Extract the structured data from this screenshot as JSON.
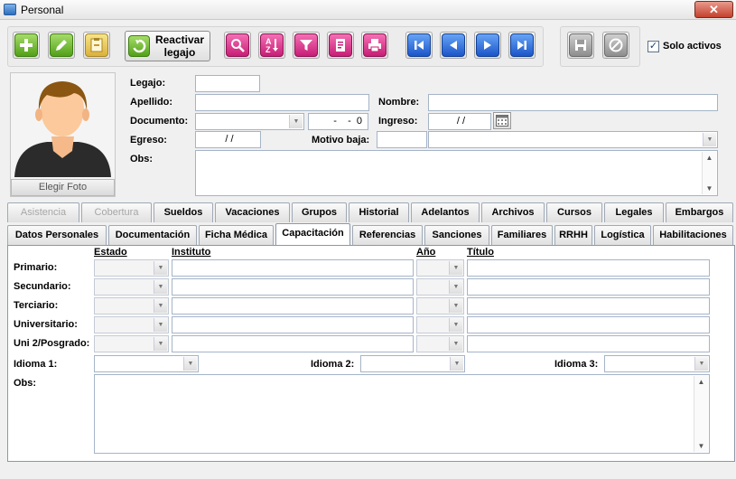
{
  "window": {
    "title": "Personal",
    "close_glyph": "✕"
  },
  "toolbar": {
    "buttons": [
      {
        "icon": "add-icon",
        "color": "#52a018"
      },
      {
        "icon": "edit-icon",
        "color": "#52a018"
      },
      {
        "icon": "paste-icon",
        "color": "#dcb13a"
      }
    ],
    "reactivar_label": "Reactivar legajo",
    "search_buttons": [
      {
        "icon": "search-icon",
        "color": "#c81d76"
      },
      {
        "icon": "sort-az-icon",
        "color": "#c81d76"
      },
      {
        "icon": "filter-icon",
        "color": "#c81d76"
      },
      {
        "icon": "report-icon",
        "color": "#c81d76"
      },
      {
        "icon": "print-icon",
        "color": "#c81d76"
      }
    ],
    "nav_buttons": [
      {
        "icon": "first-record-icon"
      },
      {
        "icon": "previous-record-icon"
      },
      {
        "icon": "next-record-icon"
      },
      {
        "icon": "last-record-icon"
      }
    ],
    "save_icon": "save-icon",
    "cancel_icon": "cancel-icon",
    "solo_activos_label": "Solo activos",
    "solo_activos_checked": true
  },
  "photo": {
    "button_label": "Elegir Foto"
  },
  "form": {
    "legajo_label": "Legajo:",
    "legajo_value": "",
    "apellido_label": "Apellido:",
    "apellido_value": "",
    "nombre_label": "Nombre:",
    "nombre_value": "",
    "documento_label": "Documento:",
    "documento_type": "",
    "documento_number": "  -    -  0",
    "ingreso_label": "Ingreso:",
    "ingreso_value": " / /",
    "egreso_label": "Egreso:",
    "egreso_value": " / /",
    "motivo_baja_label": "Motivo baja:",
    "motivo_baja_code": "",
    "motivo_baja_value": "",
    "obs_label": "Obs:",
    "obs_value": ""
  },
  "tabs_row1": [
    {
      "label": "Asistencia",
      "enabled": false
    },
    {
      "label": "Cobertura",
      "enabled": false
    },
    {
      "label": "Sueldos",
      "enabled": true
    },
    {
      "label": "Vacaciones",
      "enabled": true
    },
    {
      "label": "Grupos",
      "enabled": true
    },
    {
      "label": "Historial",
      "enabled": true
    },
    {
      "label": "Adelantos",
      "enabled": true
    },
    {
      "label": "Archivos",
      "enabled": true
    },
    {
      "label": "Cursos",
      "enabled": true
    },
    {
      "label": "Legales",
      "enabled": true
    },
    {
      "label": "Embargos",
      "enabled": true
    }
  ],
  "tabs_row2": [
    {
      "label": "Datos Personales",
      "selected": false
    },
    {
      "label": "Documentación",
      "selected": false
    },
    {
      "label": "Ficha Médica",
      "selected": false
    },
    {
      "label": "Capacitación",
      "selected": true
    },
    {
      "label": "Referencias",
      "selected": false
    },
    {
      "label": "Sanciones",
      "selected": false
    },
    {
      "label": "Familiares",
      "selected": false
    },
    {
      "label": "RRHH",
      "selected": false
    },
    {
      "label": "Logística",
      "selected": false
    },
    {
      "label": "Habilitaciones",
      "selected": false
    }
  ],
  "capacitacion": {
    "headers": {
      "estado": "Estado",
      "instituto": "Instituto",
      "anio": "Año",
      "titulo": "Título"
    },
    "rows": [
      {
        "label": "Primario:",
        "estado": "",
        "instituto": "",
        "anio": "",
        "titulo": ""
      },
      {
        "label": "Secundario:",
        "estado": "",
        "instituto": "",
        "anio": "",
        "titulo": ""
      },
      {
        "label": "Terciario:",
        "estado": "",
        "instituto": "",
        "anio": "",
        "titulo": ""
      },
      {
        "label": "Universitario:",
        "estado": "",
        "instituto": "",
        "anio": "",
        "titulo": ""
      },
      {
        "label": "Uni 2/Posgrado:",
        "estado": "",
        "instituto": "",
        "anio": "",
        "titulo": ""
      }
    ],
    "idioma1_label": "Idioma 1:",
    "idioma1_value": "",
    "idioma2_label": "Idioma 2:",
    "idioma2_value": "",
    "idioma3_label": "Idioma 3:",
    "idioma3_value": "",
    "obs_label": "Obs:",
    "obs_value": ""
  }
}
